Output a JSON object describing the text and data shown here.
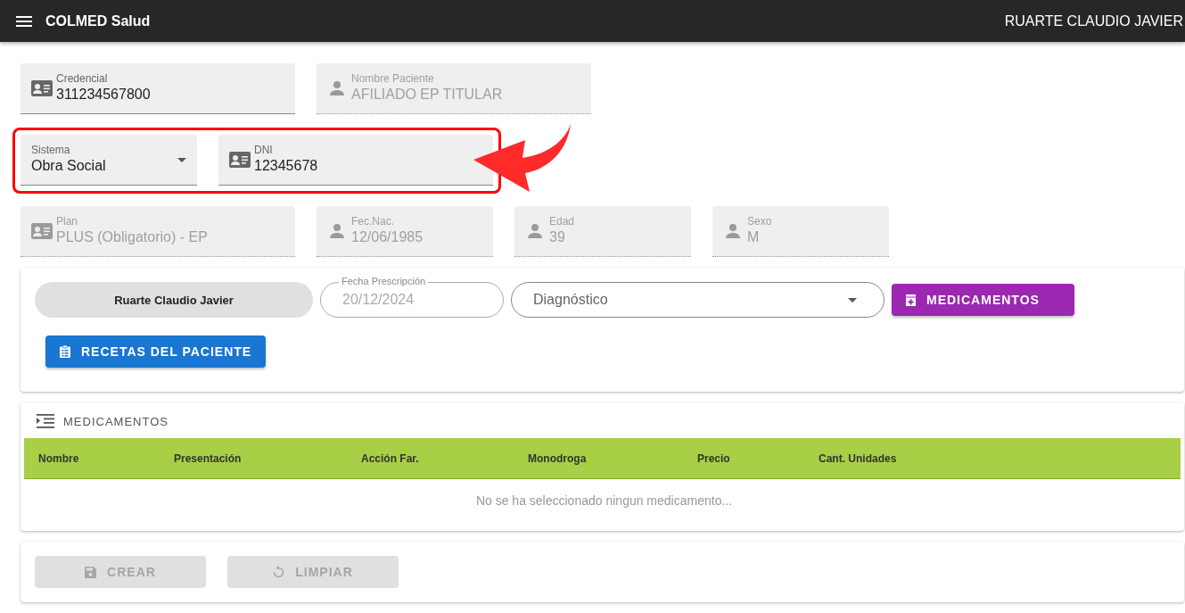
{
  "app_bar": {
    "title": "COLMED Salud",
    "user": "RUARTE CLAUDIO JAVIER"
  },
  "field_rows": [
    [
      {
        "kind": "text",
        "label": "Credencial",
        "value": "311234567800",
        "disabled": false
      },
      {
        "kind": "text",
        "label": "Nombre Paciente",
        "value": "AFILIADO EP TITULAR",
        "disabled": true
      }
    ],
    [
      {
        "kind": "select",
        "label": "Sistema",
        "value": "Obra Social",
        "disabled": false
      },
      {
        "kind": "text",
        "label": "DNI",
        "value": "12345678",
        "disabled": false
      }
    ],
    [
      {
        "kind": "text",
        "label": "Plan",
        "value": "PLUS (Obligatorio) - EP",
        "disabled": true
      },
      {
        "kind": "text",
        "label": "Fec.Nac.",
        "value": "12/06/1985",
        "disabled": true
      },
      {
        "kind": "text",
        "label": "Edad",
        "value": "39",
        "disabled": true
      },
      {
        "kind": "text",
        "label": "Sexo",
        "value": "M",
        "disabled": true
      }
    ]
  ],
  "prescription": {
    "doctor": "Ruarte Claudio Javier",
    "date_label": "Fecha Prescripción",
    "date": "20/12/2024",
    "diagnosis_placeholder": "Diagnóstico",
    "medicamentos_button": "MEDICAMENTOS",
    "recetas_button": "RECETAS DEL PACIENTE"
  },
  "medicamentos": {
    "title": "MEDICAMENTOS",
    "columns": [
      "Nombre",
      "Presentación",
      "Acción Far.",
      "Monodroga",
      "Precio",
      "Cant. Unidades"
    ],
    "empty_message": "No se ha seleccionado ningun medicamento..."
  },
  "actions": [
    {
      "label": "CREAR",
      "disabled": true
    },
    {
      "label": "LIMPIAR",
      "disabled": true
    }
  ]
}
